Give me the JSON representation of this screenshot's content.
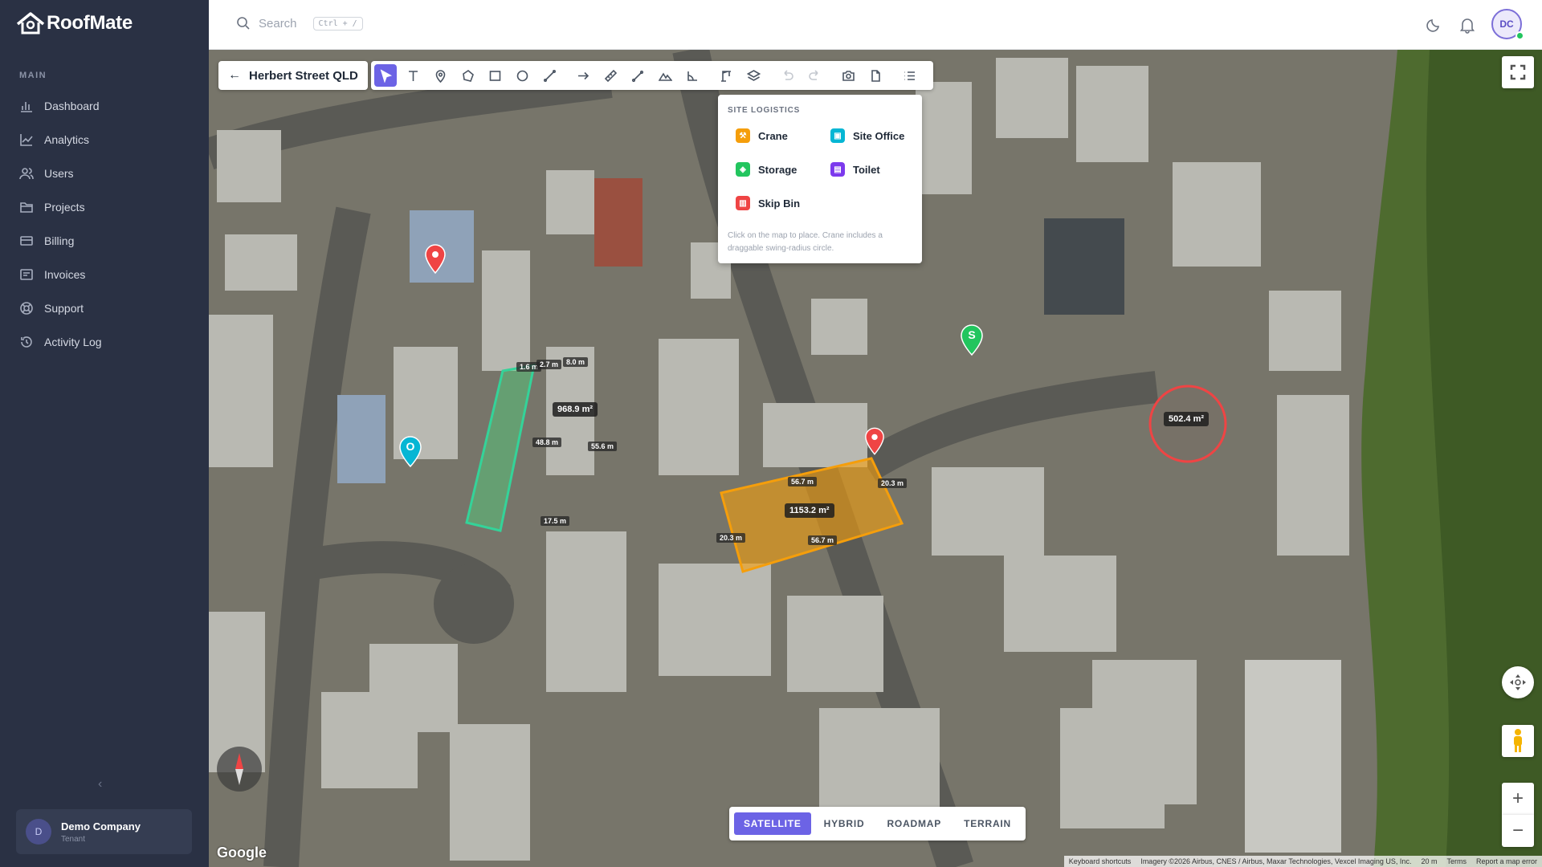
{
  "app": {
    "name": "RoofMate"
  },
  "sidebar": {
    "section": "MAIN",
    "items": [
      {
        "label": "Dashboard",
        "icon": "bar-chart-icon"
      },
      {
        "label": "Analytics",
        "icon": "line-chart-icon"
      },
      {
        "label": "Users",
        "icon": "users-icon"
      },
      {
        "label": "Projects",
        "icon": "folder-icon"
      },
      {
        "label": "Billing",
        "icon": "credit-card-icon"
      },
      {
        "label": "Invoices",
        "icon": "invoice-icon"
      },
      {
        "label": "Support",
        "icon": "lifebuoy-icon"
      },
      {
        "label": "Activity Log",
        "icon": "history-icon"
      }
    ],
    "collapse": "‹",
    "tenant": {
      "initial": "D",
      "name": "Demo Company",
      "role": "Tenant"
    }
  },
  "topbar": {
    "search_placeholder": "Search",
    "search_shortcut": "Ctrl + /",
    "user_initials": "DC"
  },
  "map": {
    "location": "Herbert Street QLD",
    "logistics": {
      "title": "SITE LOGISTICS",
      "items": [
        {
          "label": "Crane",
          "color": "#f59e0b"
        },
        {
          "label": "Site Office",
          "color": "#06b6d4"
        },
        {
          "label": "Storage",
          "color": "#22c55e"
        },
        {
          "label": "Toilet",
          "color": "#7c3aed"
        },
        {
          "label": "Skip Bin",
          "color": "#ef4444"
        }
      ],
      "hint": "Click on the map to place. Crane includes a draggable swing-radius circle."
    },
    "areas": {
      "green": {
        "area": "968.9 m²",
        "sides": [
          "1.6 m",
          "2.7 m",
          "8.0 m",
          "48.8 m",
          "55.6 m",
          "17.5 m"
        ]
      },
      "orange": {
        "area": "1153.2 m²",
        "sides": [
          "56.7 m",
          "20.3 m",
          "20.3 m",
          "56.7 m"
        ]
      },
      "circle": {
        "area": "502.4 m²"
      }
    },
    "markers": {
      "office_letter": "O",
      "storage_letter": "S"
    },
    "map_types": [
      "SATELLITE",
      "HYBRID",
      "ROADMAP",
      "TERRAIN"
    ],
    "active_map_type": "SATELLITE",
    "zoom_in": "+",
    "zoom_out": "−",
    "google": "Google",
    "attribution": [
      "Keyboard shortcuts",
      "Imagery ©2026 Airbus, CNES / Airbus, Maxar Technologies, Vexcel Imaging US, Inc.",
      "20 m",
      "Terms",
      "Report a map error"
    ]
  },
  "colors": {
    "accent": "#6c63e5",
    "sidebar": "#2a3144",
    "green_area": "#34d399",
    "orange_area": "#f59e0b",
    "marker_red": "#ef4444",
    "marker_cyan": "#06b6d4",
    "marker_green": "#22c55e"
  }
}
